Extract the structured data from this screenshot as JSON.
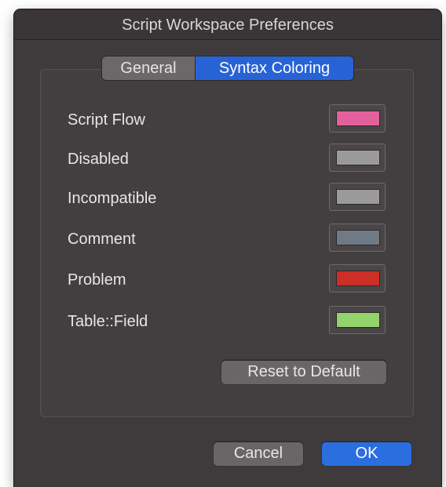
{
  "window": {
    "title": "Script Workspace Preferences"
  },
  "tabs": [
    {
      "label": "General",
      "selected": false
    },
    {
      "label": "Syntax Coloring",
      "selected": true
    }
  ],
  "syntax_colors": [
    {
      "label": "Script Flow",
      "color": "#e4609c"
    },
    {
      "label": "Disabled",
      "color": "#9a9a9a"
    },
    {
      "label": "Incompatible",
      "color": "#9a9a9a"
    },
    {
      "label": "Comment",
      "color": "#707a84"
    },
    {
      "label": "Problem",
      "color": "#cc2f26"
    },
    {
      "label": "Table::Field",
      "color": "#93d36b"
    }
  ],
  "buttons": {
    "reset": "Reset to Default",
    "cancel": "Cancel",
    "ok": "OK"
  },
  "colors": {
    "accent": "#2a6ee0",
    "window_bg": "#3f3b3c"
  }
}
